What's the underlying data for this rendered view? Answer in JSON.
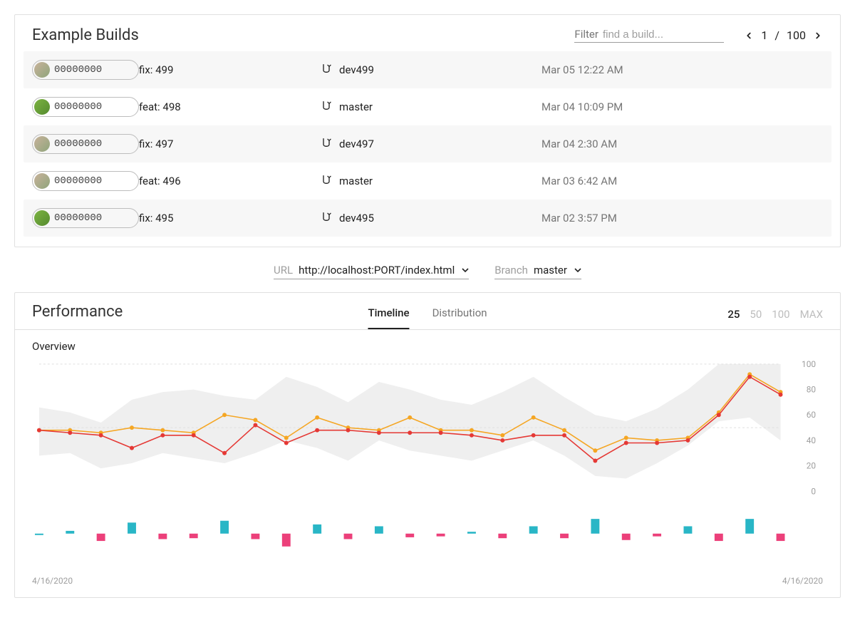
{
  "builds_panel": {
    "title": "Example Builds",
    "filter_label": "Filter",
    "filter_placeholder": "find a build...",
    "page_current": "1",
    "page_total": "100",
    "rows": [
      {
        "hash": "00000000",
        "message": "fix: 499",
        "branch": "dev499",
        "date": "Mar 05 12:22 AM",
        "avatar": "a"
      },
      {
        "hash": "00000000",
        "message": "feat: 498",
        "branch": "master",
        "date": "Mar 04 10:09 PM",
        "avatar": "b"
      },
      {
        "hash": "00000000",
        "message": "fix: 497",
        "branch": "dev497",
        "date": "Mar 04 2:30 AM",
        "avatar": "a"
      },
      {
        "hash": "00000000",
        "message": "feat: 496",
        "branch": "master",
        "date": "Mar 03 6:42 AM",
        "avatar": "a"
      },
      {
        "hash": "00000000",
        "message": "fix: 495",
        "branch": "dev495",
        "date": "Mar 02 3:57 PM",
        "avatar": "b"
      }
    ]
  },
  "selectors": {
    "url_label": "URL",
    "url_value": "http://localhost:PORT/index.html",
    "branch_label": "Branch",
    "branch_value": "master"
  },
  "perf_panel": {
    "title": "Performance",
    "tabs": {
      "timeline": "Timeline",
      "distribution": "Distribution"
    },
    "ranges": {
      "r25": "25",
      "r50": "50",
      "r100": "100",
      "rmax": "MAX"
    },
    "chart_title": "Overview",
    "date_left": "4/16/2020",
    "date_right": "4/16/2020"
  },
  "chart_data": {
    "overview_line": {
      "type": "line",
      "title": "Overview",
      "ylabel": "",
      "ylim": [
        0,
        100
      ],
      "yticks": [
        0,
        20,
        40,
        60,
        80,
        100
      ],
      "x_date_start": "4/16/2020",
      "x_date_end": "4/16/2020",
      "n_points": 25,
      "series": [
        {
          "name": "band_upper",
          "color": "#eeeeee",
          "values": [
            66,
            62,
            54,
            72,
            78,
            80,
            75,
            72,
            90,
            82,
            70,
            86,
            80,
            72,
            68,
            78,
            90,
            74,
            60,
            55,
            65,
            80,
            100,
            100,
            100
          ]
        },
        {
          "name": "band_lower",
          "color": "#eeeeee",
          "values": [
            28,
            30,
            18,
            22,
            30,
            26,
            22,
            30,
            40,
            34,
            24,
            40,
            32,
            28,
            24,
            32,
            40,
            28,
            12,
            10,
            22,
            36,
            55,
            58,
            40
          ]
        },
        {
          "name": "orange",
          "color": "#f5a623",
          "values": [
            48,
            48,
            46,
            50,
            48,
            46,
            60,
            56,
            42,
            58,
            50,
            48,
            58,
            48,
            48,
            44,
            58,
            48,
            32,
            42,
            40,
            42,
            62,
            92,
            78
          ]
        },
        {
          "name": "red",
          "color": "#e53935",
          "values": [
            48,
            46,
            44,
            34,
            44,
            44,
            30,
            52,
            38,
            48,
            48,
            46,
            46,
            46,
            44,
            40,
            44,
            44,
            24,
            38,
            38,
            40,
            60,
            90,
            76
          ]
        }
      ]
    },
    "delta_bars": {
      "type": "bar",
      "n_points": 25,
      "note": "positive = teal (up), negative = pink (down)",
      "values": [
        0,
        3,
        -8,
        12,
        -6,
        -5,
        14,
        -6,
        -14,
        10,
        -6,
        8,
        -4,
        -3,
        2,
        -5,
        8,
        -5,
        16,
        -7,
        -3,
        8,
        -8,
        16,
        -8
      ],
      "positive_color": "#29b6c6",
      "negative_color": "#ec407a",
      "last_is_pink": [
        0,
        0,
        0,
        0,
        0,
        0,
        0,
        0,
        0,
        0,
        0,
        0,
        0,
        0,
        0,
        0,
        0,
        0,
        0,
        0,
        0,
        0,
        0,
        0,
        1
      ]
    }
  }
}
